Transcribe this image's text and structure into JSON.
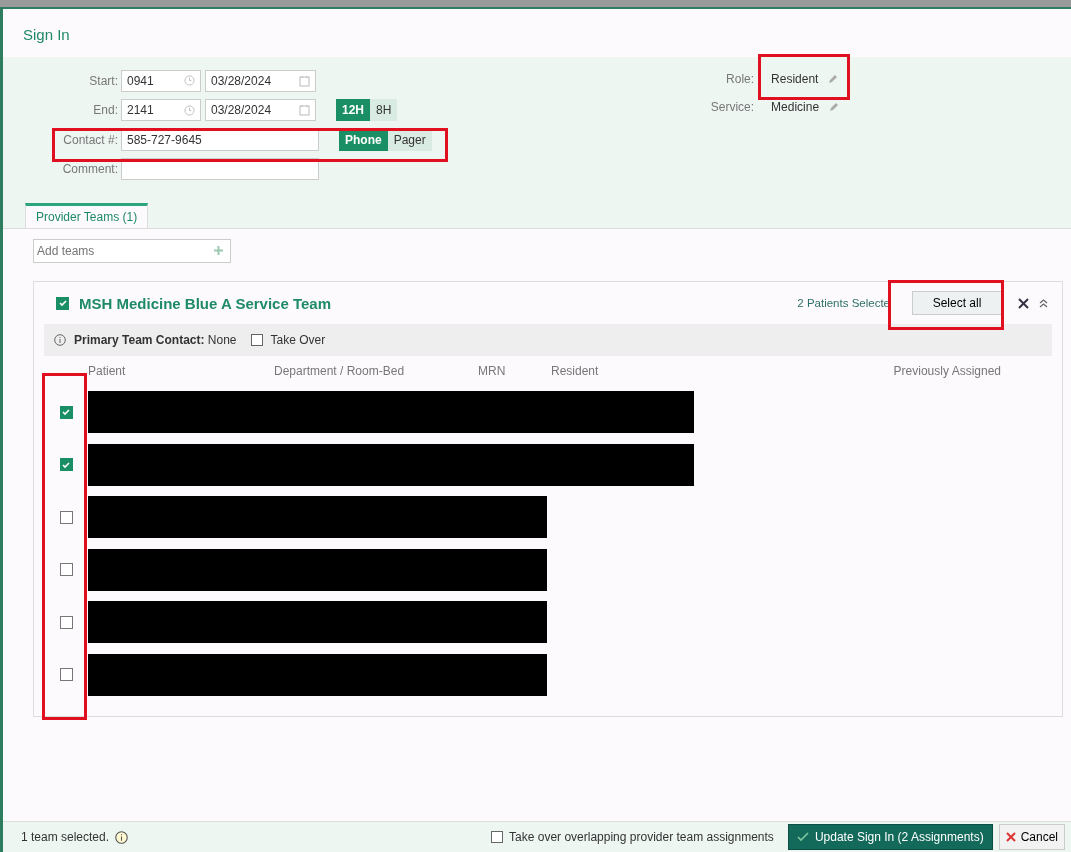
{
  "window": {
    "title": "Sign In"
  },
  "form": {
    "start_time": "0941",
    "start_date": "03/28/2024",
    "end_time": "2141",
    "end_date": "03/28/2024",
    "start_label": "Start:",
    "end_label": "End:",
    "contact_label": "Contact #:",
    "contact": "585-727-9645",
    "comment_label": "Comment:",
    "shift_options": [
      {
        "label": "12H",
        "selected": true
      },
      {
        "label": "8H",
        "selected": false
      }
    ],
    "contact_types": [
      {
        "label": "Phone",
        "selected": true
      },
      {
        "label": "Pager",
        "selected": false
      }
    ],
    "role_label": "Role:",
    "role": "Resident",
    "service_label": "Service:",
    "service": "Medicine"
  },
  "tabs": [
    {
      "label": "Provider Teams (1)",
      "selected": true
    }
  ],
  "add_teams": {
    "placeholder": "Add teams"
  },
  "team": {
    "name": "MSH Medicine Blue A Service Team",
    "checked": true,
    "selected_count": "2 Patients Selecte",
    "select_all": "Select all",
    "primary_contact_label": "Primary Team Contact:",
    "primary_contact": "None",
    "take_over": {
      "label": "Take Over",
      "checked": false
    },
    "columns": [
      "Patient",
      "Department / Room-Bed",
      "MRN",
      "Resident",
      "Previously Assigned"
    ],
    "rows": [
      {
        "checked": true,
        "kind": "wide"
      },
      {
        "checked": true,
        "kind": "wide"
      },
      {
        "checked": false,
        "kind": "narrow"
      },
      {
        "checked": false,
        "kind": "narrow"
      },
      {
        "checked": false,
        "kind": "narrow"
      },
      {
        "checked": false,
        "kind": "narrow"
      }
    ]
  },
  "footer": {
    "status": "1 team selected.",
    "take_over_overlapping": {
      "label": "Take over overlapping provider team assignments",
      "checked": false
    },
    "update_button": "Update Sign In (2 Assignments)",
    "cancel_button": "Cancel"
  }
}
